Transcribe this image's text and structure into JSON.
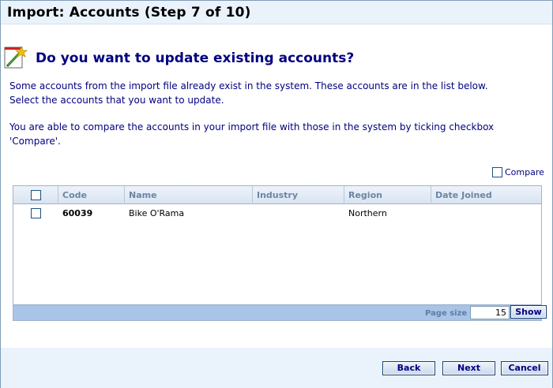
{
  "window": {
    "title": "Import: Accounts (Step 7 of 10)"
  },
  "page": {
    "question": "Do you want to update existing accounts?",
    "para1_line1": "Some accounts from the import file already exist in the system. These accounts are in the list below.",
    "para1_line2": "Select the accounts that you want to update.",
    "para2_line1": "You are able to compare the accounts in your import file with those in the system by ticking checkbox",
    "para2_line2": "'Compare'.",
    "icon": "wizard-wand-icon"
  },
  "compare": {
    "label": "Compare",
    "checked": false
  },
  "grid": {
    "columns": [
      "Code",
      "Name",
      "Industry",
      "Region",
      "Date Joined"
    ],
    "rows": [
      {
        "code": "60039",
        "name": "Bike O'Rama",
        "industry": "",
        "region": "Northern",
        "date_joined": ""
      }
    ],
    "page_size_label": "Page size",
    "page_size_value": "15",
    "show_label": "Show"
  },
  "buttons": {
    "back": "Back",
    "next": "Next",
    "cancel": "Cancel"
  },
  "colors": {
    "accent": "#000080",
    "header_bg": "#eaf2fb",
    "grid_footer": "#a8c4e6"
  }
}
